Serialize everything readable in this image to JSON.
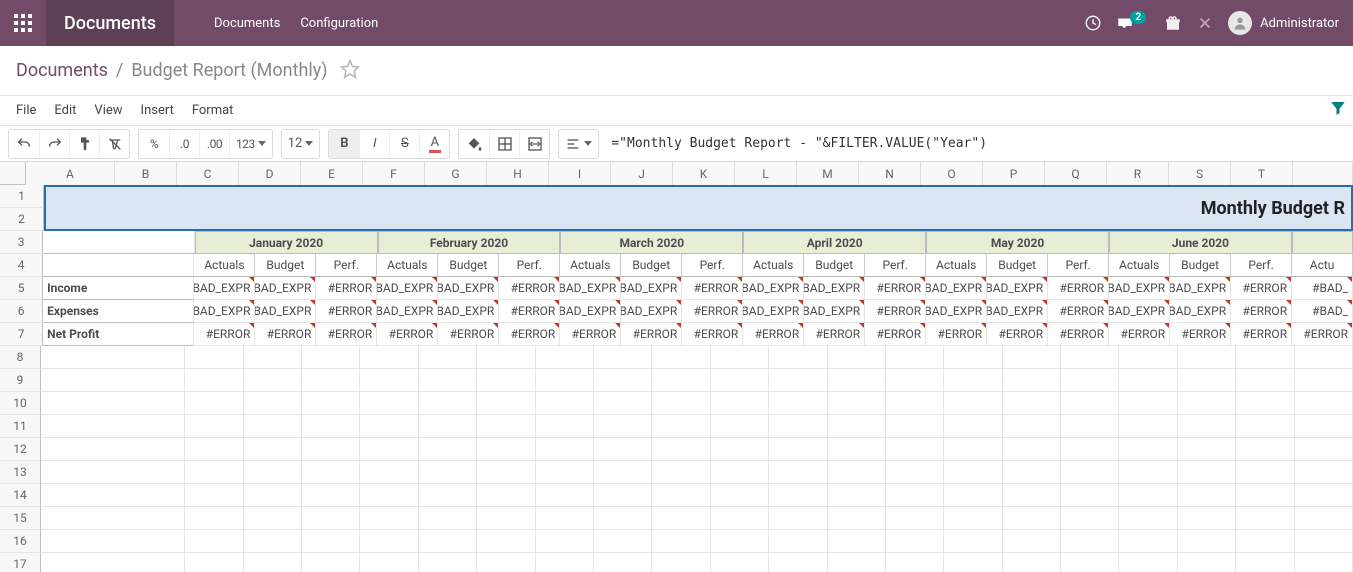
{
  "navbar": {
    "brand": "Documents",
    "menu": [
      "Documents",
      "Configuration"
    ],
    "message_count": "2",
    "user_name": "Administrator"
  },
  "breadcrumb": {
    "root": "Documents",
    "leaf": "Budget Report (Monthly)"
  },
  "menubar": [
    "File",
    "Edit",
    "View",
    "Insert",
    "Format"
  ],
  "toolbar": {
    "number_format": "123",
    "font_size": "12"
  },
  "formula": "=\"Monthly Budget Report - \"&FILTER.VALUE(\"Year\")",
  "columns": [
    "A",
    "B",
    "C",
    "D",
    "E",
    "F",
    "G",
    "H",
    "I",
    "J",
    "K",
    "L",
    "M",
    "N",
    "O",
    "P",
    "Q",
    "R",
    "S",
    "T"
  ],
  "row_numbers": [
    "1",
    "2",
    "3",
    "4",
    "5",
    "6",
    "7",
    "8",
    "9",
    "10",
    "11",
    "12",
    "13",
    "14",
    "15",
    "16",
    "17"
  ],
  "title_cell": "Monthly Budget R",
  "months": [
    "January 2020",
    "February 2020",
    "March 2020",
    "April 2020",
    "May 2020",
    "June 2020"
  ],
  "sub_headers": [
    "Actuals",
    "Budget",
    "Perf."
  ],
  "row_labels": [
    "Income",
    "Expenses",
    "Net Profit"
  ],
  "errors": {
    "bad_expr": "#BAD_EXPR",
    "error": "#ERROR",
    "bad_partial": "#BAD_"
  },
  "chart_data": {
    "type": "table",
    "title": "Monthly Budget Report",
    "columns_group": [
      "January 2020",
      "February 2020",
      "March 2020",
      "April 2020",
      "May 2020",
      "June 2020"
    ],
    "columns_sub": [
      "Actuals",
      "Budget",
      "Perf."
    ],
    "rows": [
      "Income",
      "Expenses",
      "Net Profit"
    ],
    "values_note": "All visible cells contain error values (#BAD_EXPR / #ERROR); no numeric data is rendered.",
    "income": {
      "pattern": [
        "#BAD_EXPR",
        "#BAD_EXPR",
        "#ERROR"
      ],
      "repeat": 6,
      "tail": "#BAD_"
    },
    "expenses": {
      "pattern": [
        "#BAD_EXPR",
        "#BAD_EXPR",
        "#ERROR"
      ],
      "repeat": 6,
      "tail": "#BAD_"
    },
    "net_profit": {
      "pattern": [
        "#ERROR",
        "#ERROR",
        "#ERROR"
      ],
      "repeat": 6,
      "tail": "#ERROR"
    }
  },
  "extra_headers": {
    "actuals_partial": "Actu"
  }
}
